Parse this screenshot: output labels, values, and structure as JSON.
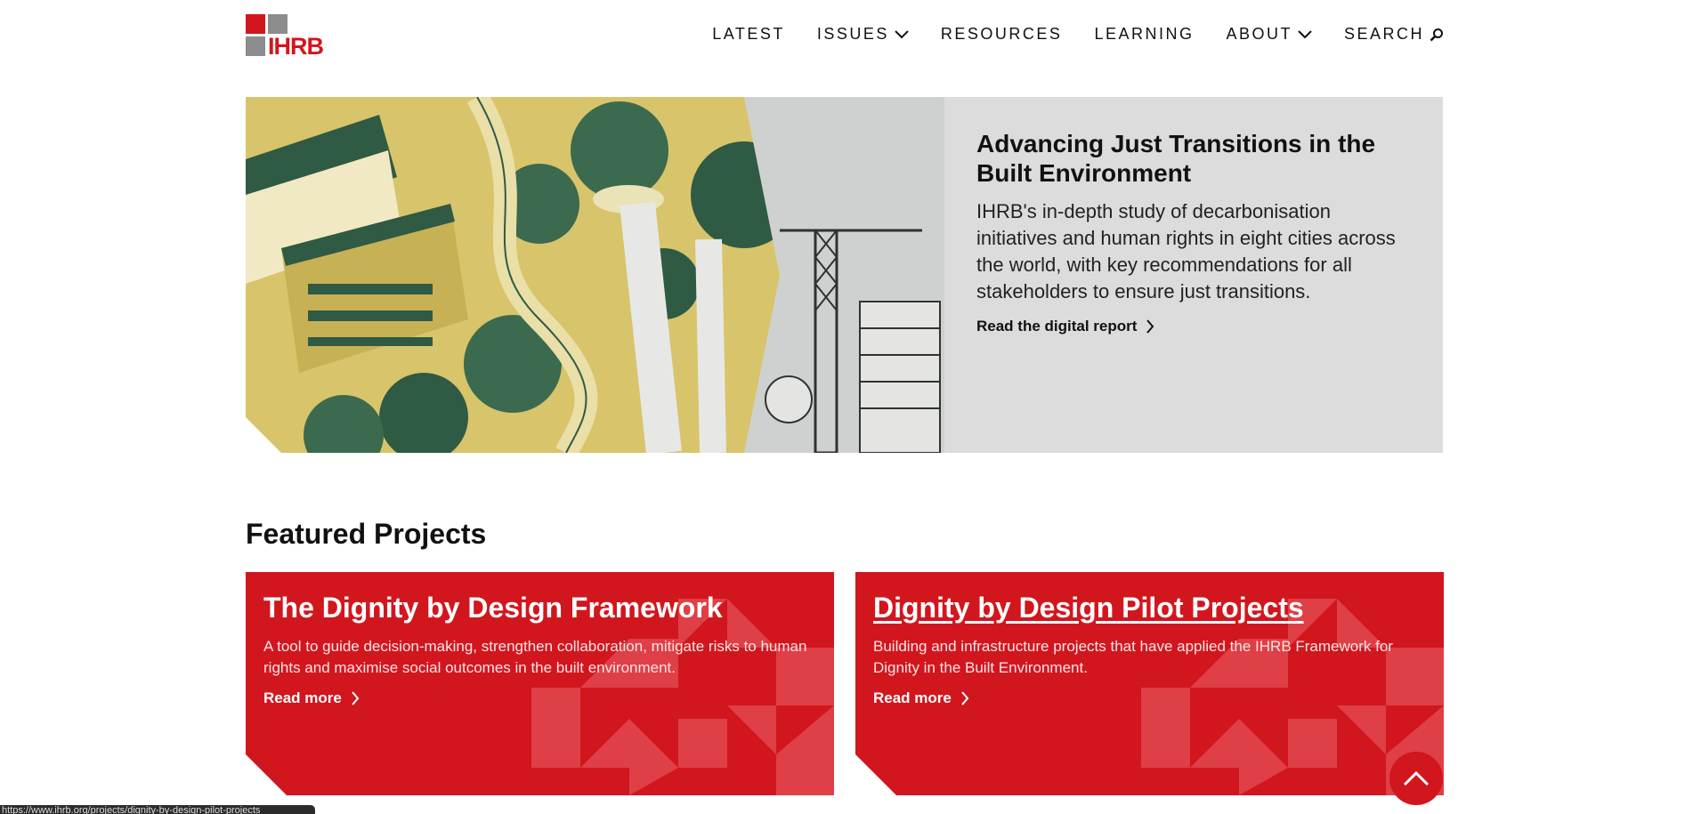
{
  "logo": {
    "text": "IHRB",
    "icon": "ihrb-logo"
  },
  "nav": {
    "items": [
      {
        "label": "LATEST"
      },
      {
        "label": "ISSUES",
        "icon": "chevron-down-icon"
      },
      {
        "label": "RESOURCES"
      },
      {
        "label": "LEARNING"
      },
      {
        "label": "ABOUT",
        "icon": "chevron-down-icon"
      },
      {
        "label": "SEARCH",
        "icon": "search-icon"
      }
    ]
  },
  "hero": {
    "image": "built-environment-illustration",
    "title": "Advancing Just Transitions in the Built Environment",
    "description": "IHRB's in-depth study of decarbonisation initiatives and human rights in eight cities across the world, with key recommendations for all stakeholders to ensure just transitions.",
    "link": "Read the digital report"
  },
  "featured": {
    "title": "Featured Projects",
    "cards": [
      {
        "title": "The Dignity by Design Framework",
        "description": "A tool to guide decision-making, strengthen collaboration, mitigate risks to human rights and maximise social outcomes in the built environment.",
        "link": "Read more"
      },
      {
        "title": "Dignity by Design Pilot Projects",
        "description": "Building and infrastructure projects that have applied the IHRB Framework for Dignity in the Built Environment.",
        "link": "Read more"
      }
    ]
  },
  "colors": {
    "brand_red": "#d2161e",
    "grey": "#8c8c8c",
    "panel": "#dcdcdc"
  },
  "status_bar": {
    "url": "https://www.ihrb.org/projects/dignity-by-design-pilot-projects"
  }
}
